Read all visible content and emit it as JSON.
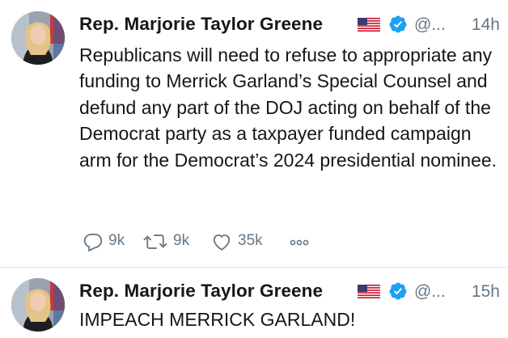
{
  "tweets": [
    {
      "name": "Rep. Marjorie Taylor Greene",
      "handle": "@...",
      "time": "14h",
      "text": "Republicans will need to refuse to appropriate any funding to Merrick Garland’s Special Counsel and defund any part of the DOJ acting on behalf of the Democrat party as a taxpayer funded campaign arm for the Democrat’s 2024 presidential nominee.",
      "replies": "9k",
      "retweets": "9k",
      "likes": "35k",
      "more_icon": "ellipsis-icon"
    },
    {
      "name": "Rep. Marjorie Taylor Greene",
      "handle": "@...",
      "time": "15h",
      "text": "IMPEACH MERRICK GARLAND!"
    }
  ],
  "colors": {
    "text": "#14171a",
    "secondary": "#657786",
    "verified": "#1da1f2",
    "divider": "#e1e8ed"
  },
  "icons": [
    "us-flag-icon",
    "verified-badge-icon",
    "reply-icon",
    "retweet-icon",
    "like-icon",
    "more-icon"
  ]
}
